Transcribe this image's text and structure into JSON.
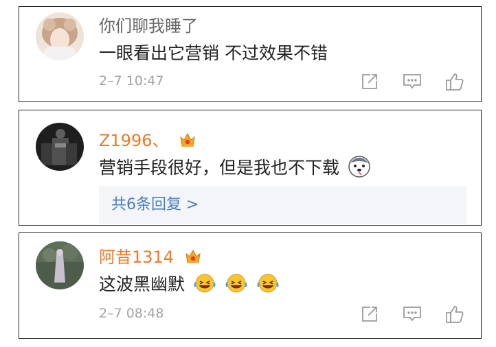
{
  "comments": [
    {
      "username": "你们聊我睡了",
      "text": "一眼看出它营销 不过效果不错",
      "time": "2–7 10:47"
    },
    {
      "username": "Z1996",
      "username_suffix": "、",
      "text": "营销手段很好，但是我也不下载",
      "replies_label": "共6条回复 >"
    },
    {
      "username": "阿昔1314",
      "text": "这波黑幽默",
      "time": "2–7 08:48"
    }
  ],
  "icons": {
    "share": "share-icon",
    "comment": "comment-icon",
    "like": "thumbs-up-icon",
    "badge": "crown-badge-icon",
    "emoji_husky": "husky-emoji-icon",
    "emoji_laugh": "laughing-tears-emoji-icon"
  },
  "colors": {
    "username_vip": "#ef7822",
    "username_plain": "#666666",
    "timestamp": "#a3a3a3",
    "reply_link": "#4a7fbf",
    "reply_bg": "#f3f5f8"
  }
}
